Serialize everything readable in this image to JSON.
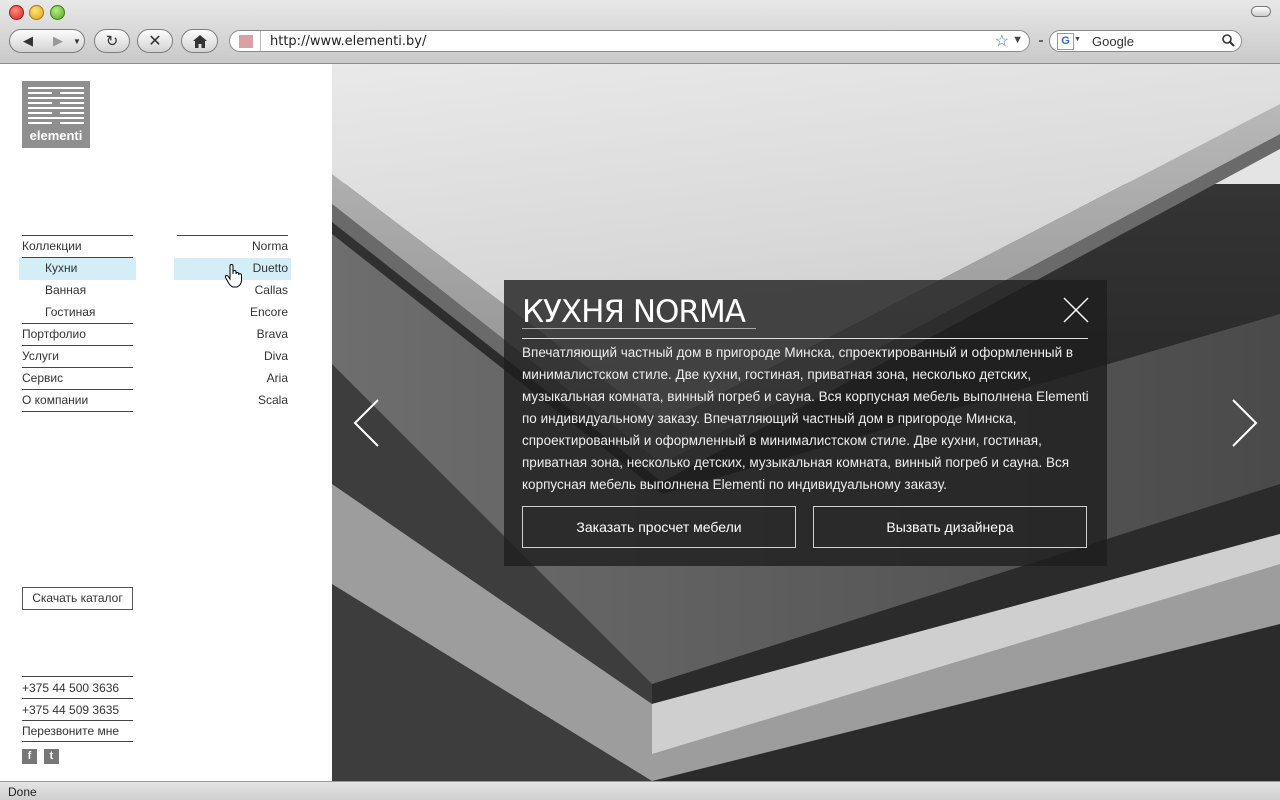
{
  "browser": {
    "url": "http://www.elementi.by/",
    "search_engine": "Google",
    "search_placeholder": "Google",
    "status": "Done"
  },
  "site": {
    "logo_text": "elementi",
    "menu_left": [
      {
        "label": "Коллекции",
        "sub": false,
        "active": false
      },
      {
        "label": "Кухни",
        "sub": true,
        "active": true
      },
      {
        "label": "Ванная",
        "sub": true,
        "active": false
      },
      {
        "label": "Гостиная",
        "sub": true,
        "active": false
      },
      {
        "label": "Портфолио",
        "sub": false,
        "active": false
      },
      {
        "label": "Услуги",
        "sub": false,
        "active": false
      },
      {
        "label": "Сервис",
        "sub": false,
        "active": false
      },
      {
        "label": "О компании",
        "sub": false,
        "active": false
      }
    ],
    "menu_right": [
      {
        "label": "Norma",
        "active": false
      },
      {
        "label": "Duetto",
        "active": true
      },
      {
        "label": "Callas",
        "active": false
      },
      {
        "label": "Encore",
        "active": false
      },
      {
        "label": "Brava",
        "active": false
      },
      {
        "label": "Diva",
        "active": false
      },
      {
        "label": "Aria",
        "active": false
      },
      {
        "label": "Scala",
        "active": false
      }
    ],
    "catalog_label": "Скачать каталог",
    "phones": [
      "+375 44 500 3636",
      "+375 44 509 3635"
    ],
    "callback_label": "Перезвоните мне",
    "social": [
      {
        "icon": "facebook-icon",
        "glyph": "f"
      },
      {
        "icon": "twitter-icon",
        "glyph": "t"
      }
    ]
  },
  "panel": {
    "title": "КУХНЯ NORMA",
    "description": "Впечатляющий частный дом в пригороде Минска, спроектированный и оформленный в минималистском стиле. Две кухни, гостиная, приватная зона, несколько детских, музыкальная комната, винный погреб и сауна. Вся корпусная мебель выполнена Elementi по индивидуальному заказу. Впечатляющий частный дом в пригороде Минска, спроектированный и оформленный в минималистском стиле. Две кухни, гостиная, приватная зона, несколько детских, музыкальная комната, винный погреб и сауна. Вся корпусная мебель выполнена Elementi по индивидуальному заказу.",
    "order_label": "Заказать просчет мебели",
    "designer_label": "Вызвать дизайнера"
  }
}
